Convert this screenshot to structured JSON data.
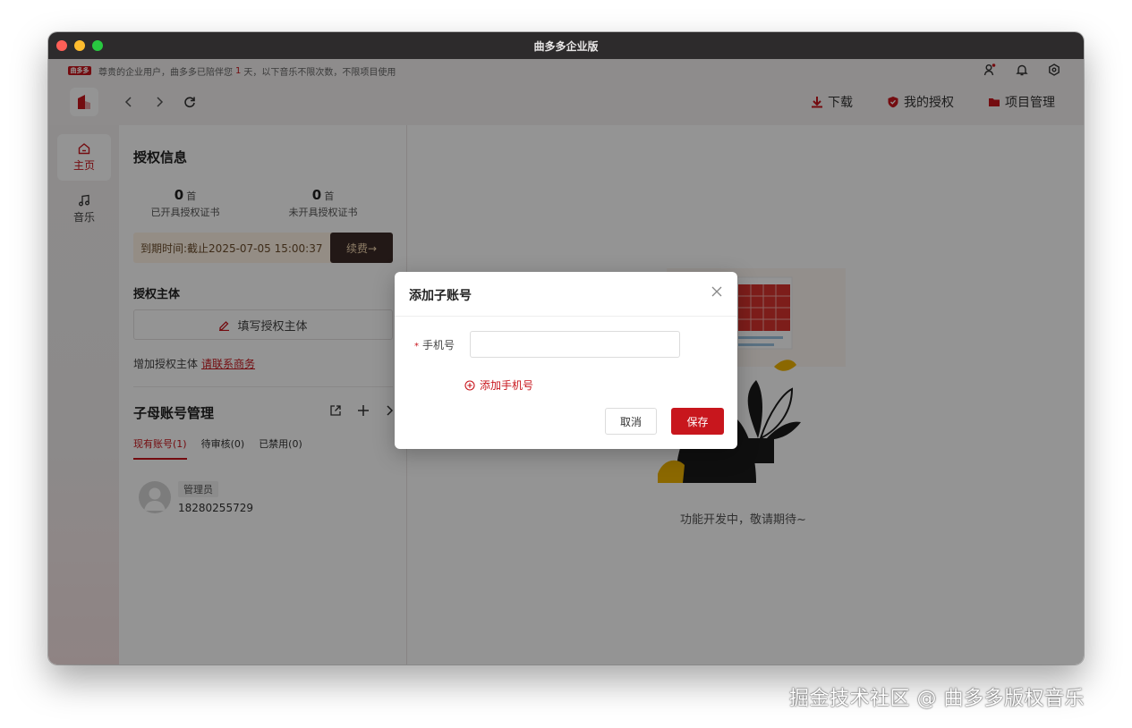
{
  "window": {
    "title": "曲多多企业版"
  },
  "notice": {
    "logo_text": "曲多多",
    "text_before": "尊贵的企业用户，曲多多已陪伴您",
    "days": "1",
    "text_after": "天，以下音乐不限次数，不限项目使用"
  },
  "top_icons": [
    "user-icon",
    "bell-icon",
    "settings-icon"
  ],
  "header": {
    "actions": [
      {
        "label": "下载",
        "icon": "download-icon"
      },
      {
        "label": "我的授权",
        "icon": "shield-icon"
      },
      {
        "label": "项目管理",
        "icon": "folder-icon"
      }
    ]
  },
  "sidebar": {
    "items": [
      {
        "label": "主页",
        "icon": "home-icon",
        "active": true
      },
      {
        "label": "音乐",
        "icon": "music-icon",
        "active": false
      }
    ]
  },
  "auth_info": {
    "title": "授权信息",
    "issued": {
      "count": "0",
      "unit": "首",
      "label": "已开具授权证书"
    },
    "not_issued": {
      "count": "0",
      "unit": "首",
      "label": "未开具授权证书"
    },
    "expire_text": "到期时间:截止2025-07-05 15:00:37",
    "renew_label": "续费→"
  },
  "auth_subject": {
    "title": "授权主体",
    "fill_label": "填写授权主体",
    "add_text": "增加授权主体",
    "contact_link": "请联系商务"
  },
  "sub_accounts": {
    "title": "子母账号管理",
    "tabs": [
      {
        "label": "现有账号(1)",
        "active": true
      },
      {
        "label": "待审核(0)",
        "active": false
      },
      {
        "label": "已禁用(0)",
        "active": false
      }
    ],
    "members": [
      {
        "role": "管理员",
        "phone": "18280255729"
      }
    ]
  },
  "main": {
    "dev_text": "功能开发中，敬请期待~"
  },
  "dialog": {
    "title": "添加子账号",
    "field_label": "手机号",
    "field_value": "",
    "add_phone_label": "添加手机号",
    "cancel_label": "取消",
    "save_label": "保存"
  },
  "watermark": "掘金技术社区 @ 曲多多版权音乐",
  "colors": {
    "accent": "#c8161d",
    "titlebar": "#2d2b2c"
  }
}
